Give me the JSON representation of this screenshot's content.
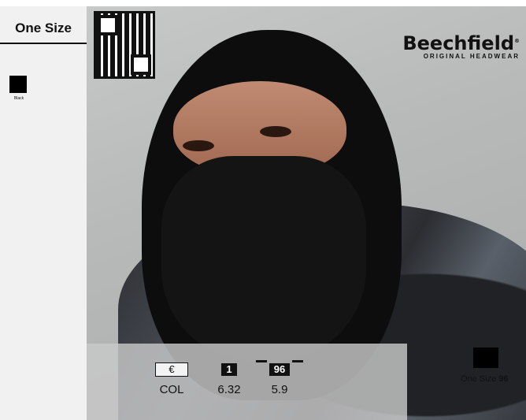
{
  "sidebar": {
    "size_label": "One Size",
    "swatch_label": "Black"
  },
  "brand": {
    "name": "Beechfield",
    "registered": "®",
    "tagline": "ORIGINAL HEADWEAR"
  },
  "info": {
    "currency_label": "€",
    "currency_value": "COL",
    "pack_label": "1",
    "pack_value": "6.32",
    "carton_label": "96",
    "carton_value": "5.9"
  },
  "size_box": {
    "label": "One Size",
    "value": "96"
  },
  "colors": {
    "swatch": "#000000",
    "sidebar_bg": "#f1f1f1"
  }
}
